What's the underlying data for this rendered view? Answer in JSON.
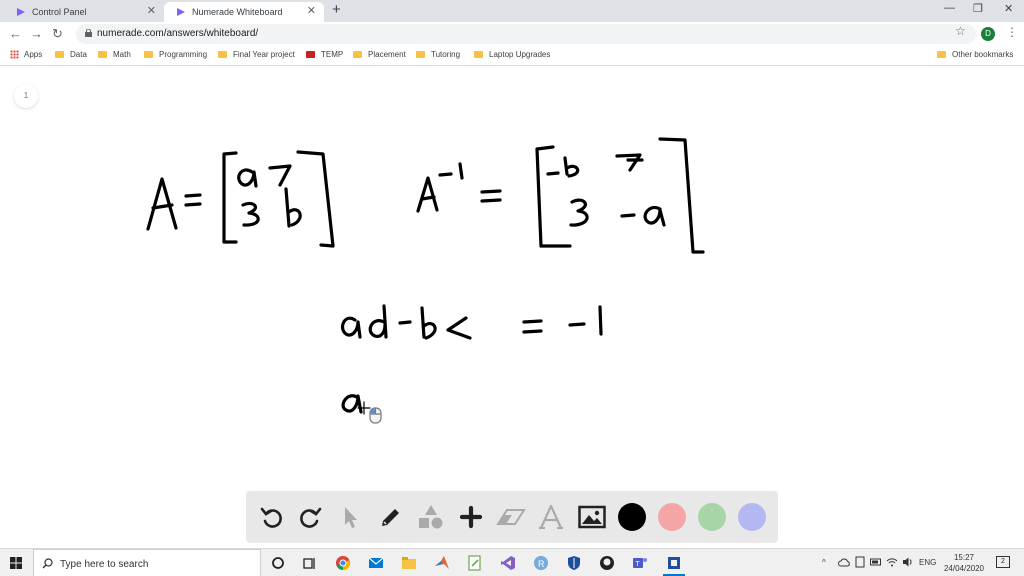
{
  "browser": {
    "tabs": [
      {
        "title": "Control Panel",
        "active": false
      },
      {
        "title": "Numerade Whiteboard",
        "active": true
      }
    ],
    "url": "numerade.com/answers/whiteboard/",
    "profile_initial": "D",
    "bookmarks": [
      "Apps",
      "Data",
      "Math",
      "Programming",
      "Final Year project",
      "TEMP",
      "Placement",
      "Tutoring",
      "Laptop Upgrades"
    ],
    "other_bookmarks": "Other bookmarks"
  },
  "whiteboard": {
    "page_number": "1",
    "handwriting": {
      "A_label": "A",
      "matrix_A": [
        [
          "a",
          "7"
        ],
        [
          "3",
          "b"
        ]
      ],
      "Ainv_label": "A",
      "Ainv_exponent": "-1",
      "matrix_Ainv": [
        [
          "-b",
          "7"
        ],
        [
          "3",
          "-a"
        ]
      ],
      "equation": "ad-bc = -1",
      "partial": "a"
    },
    "tools": [
      "undo-icon",
      "redo-icon",
      "pointer-icon",
      "pen-icon",
      "shapes-icon",
      "plus-icon",
      "eraser-icon",
      "text-icon",
      "image-icon"
    ],
    "colors": [
      "#000000",
      "#f4a6a6",
      "#a8d5a8",
      "#b3b8f2"
    ]
  },
  "taskbar": {
    "search_placeholder": "Type here to search",
    "language": "ENG",
    "time": "15:27",
    "date": "24/04/2020",
    "notifications": "2"
  }
}
